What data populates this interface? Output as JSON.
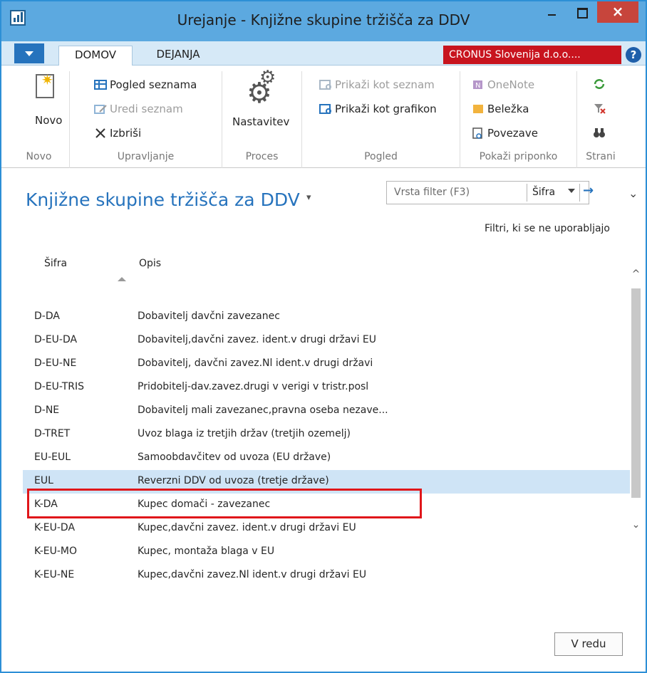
{
  "window": {
    "title": "Urejanje - Knjižne skupine tržišča za DDV",
    "minimize_icon": "minimize-icon",
    "maximize_icon": "maximize-icon",
    "close_glyph": "×"
  },
  "tabs": {
    "home": "DOMOV",
    "actions": "DEJANJA",
    "company": "CRONUS Slovenija d.o.o....",
    "help_glyph": "?"
  },
  "ribbon": {
    "novo": {
      "label": "Novo",
      "group": "Novo"
    },
    "manage": {
      "group": "Upravljanje",
      "view_list": "Pogled seznama",
      "edit_list": "Uredi seznam",
      "delete": "Izbriši"
    },
    "process": {
      "group": "Proces",
      "settings": "Nastavitev"
    },
    "view": {
      "group": "Pogled",
      "show_as_list": "Prikaži kot seznam",
      "show_as_chart": "Prikaži kot grafikon"
    },
    "attachments": {
      "group": "Pokaži priponko",
      "onenote": "OneNote",
      "note": "Beležka",
      "links": "Povezave"
    },
    "page": {
      "group": "Strani"
    }
  },
  "page": {
    "title": "Knjižne skupine tržišča za DDV",
    "filter_placeholder": "Vrsta filter (F3)",
    "filter_field": "Šifra",
    "filter_go": "→",
    "unused_filters": "Filtri, ki se ne uporabljajo"
  },
  "columns": {
    "code": "Šifra",
    "description": "Opis"
  },
  "rows": [
    {
      "code": "D-DA",
      "desc": "Dobavitelj davčni zavezanec"
    },
    {
      "code": "D-EU-DA",
      "desc": "Dobavitelj,davčni zavez. ident.v drugi državi EU"
    },
    {
      "code": "D-EU-NE",
      "desc": "Dobavitelj, davčni zavez.Nl ident.v drugi državi"
    },
    {
      "code": "D-EU-TRIS",
      "desc": "Pridobitelj-dav.zavez.drugi v verigi v tristr.posl"
    },
    {
      "code": "D-NE",
      "desc": "Dobavitelj mali zavezanec,pravna oseba nezave..."
    },
    {
      "code": "D-TRET",
      "desc": "Uvoz blaga iz tretjih držav (tretjih ozemelj)"
    },
    {
      "code": "EU-EUL",
      "desc": "Samoobdavčitev od uvoza (EU države)"
    },
    {
      "code": "EUL",
      "desc": "Reverzni DDV od uvoza (tretje države)"
    },
    {
      "code": "K-DA",
      "desc": "Kupec domači - zavezanec"
    },
    {
      "code": "K-EU-DA",
      "desc": "Kupec,davčni zavez. ident.v drugi državi EU"
    },
    {
      "code": "K-EU-MO",
      "desc": "Kupec, montaža blaga v EU"
    },
    {
      "code": "K-EU-NE",
      "desc": "Kupec,davčni zavez.Nl ident.v drugi državi EU"
    }
  ],
  "selected_row": "EUL",
  "footer": {
    "ok": "V redu"
  },
  "colors": {
    "title_bar": "#5ca9e0",
    "accent_blue": "#2673bd",
    "company_badge": "#c8141e",
    "close_button": "#c7453c",
    "selection": "#cfe4f6",
    "highlight_border": "#e0161a"
  }
}
